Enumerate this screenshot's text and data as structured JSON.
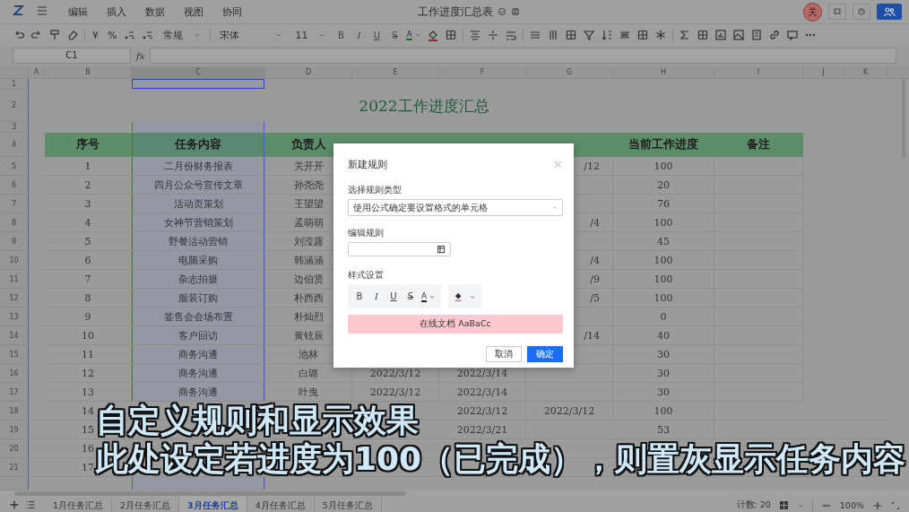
{
  "app_bar": {
    "menus": [
      "编辑",
      "插入",
      "数据",
      "视图",
      "协同"
    ],
    "doc_title": "工作进度汇总表",
    "avatar": "关"
  },
  "toolbar": {
    "currency": "¥",
    "percent": "%",
    "number_format": "常规",
    "font": "宋体",
    "font_size": "11",
    "text_styles": [
      {
        "label": "B",
        "kind": "bold"
      },
      {
        "label": "I",
        "kind": "italic"
      },
      {
        "label": "U",
        "kind": "underline"
      },
      {
        "label": "S",
        "kind": "strike"
      }
    ],
    "font_color": "A"
  },
  "formula_bar": {
    "cell": "C1",
    "fx": "fx"
  },
  "columns": [
    {
      "label": "A",
      "selected": false
    },
    {
      "label": "B",
      "selected": false
    },
    {
      "label": "C",
      "selected": true
    },
    {
      "label": "D",
      "selected": false
    },
    {
      "label": "E",
      "selected": false
    },
    {
      "label": "F",
      "selected": false
    },
    {
      "label": "G",
      "selected": false
    },
    {
      "label": "H",
      "selected": false
    },
    {
      "label": "I",
      "selected": false
    },
    {
      "label": "J",
      "selected": false
    },
    {
      "label": "K",
      "selected": false
    }
  ],
  "rows": [
    {
      "num": "1",
      "kind": "blank"
    },
    {
      "num": "2",
      "kind": "title",
      "title": "2022工作进度汇总"
    },
    {
      "num": "3",
      "kind": "blank"
    },
    {
      "num": "4",
      "kind": "header",
      "cells": {
        "b": "序号",
        "c": "任务内容",
        "d": "负责人",
        "h": "当前工作进度",
        "i": "备注"
      }
    },
    {
      "num": "5",
      "kind": "data",
      "cells": {
        "b": "1",
        "c": "二月份财务报表",
        "d": "关开开",
        "g": "/12",
        "h": "100"
      }
    },
    {
      "num": "6",
      "kind": "data",
      "cells": {
        "b": "2",
        "c": "四月公众号宣传文章",
        "d": "孙尧尧",
        "h": "20"
      }
    },
    {
      "num": "7",
      "kind": "data",
      "cells": {
        "b": "3",
        "c": "活动页策划",
        "d": "王望望",
        "h": "76"
      }
    },
    {
      "num": "8",
      "kind": "data",
      "cells": {
        "b": "4",
        "c": "女神节营销策划",
        "d": "孟萌萌",
        "g": "/4",
        "h": "100"
      }
    },
    {
      "num": "9",
      "kind": "data",
      "cells": {
        "b": "5",
        "c": "野餐活动营销",
        "d": "刘滢露",
        "h": "45"
      }
    },
    {
      "num": "10",
      "kind": "data",
      "cells": {
        "b": "6",
        "c": "电脑采购",
        "d": "韩涵涵",
        "g": "/4",
        "h": "100"
      }
    },
    {
      "num": "11",
      "kind": "data",
      "cells": {
        "b": "7",
        "c": "杂志拍摄",
        "d": "边伯贤",
        "g": "/9",
        "h": "100"
      }
    },
    {
      "num": "12",
      "kind": "data",
      "cells": {
        "b": "8",
        "c": "服装订购",
        "d": "朴西西",
        "g": "/5",
        "h": "100"
      }
    },
    {
      "num": "13",
      "kind": "data",
      "cells": {
        "b": "9",
        "c": "签售会会场布置",
        "d": "朴灿烈",
        "h": "0"
      }
    },
    {
      "num": "14",
      "kind": "data",
      "cells": {
        "b": "10",
        "c": "客户回访",
        "d": "黄铉辰",
        "g": "/14",
        "h": "40"
      }
    },
    {
      "num": "15",
      "kind": "data",
      "cells": {
        "b": "11",
        "c": "商务沟通",
        "d": "池林",
        "h": "30"
      }
    },
    {
      "num": "16",
      "kind": "data",
      "cells": {
        "b": "12",
        "c": "商务沟通",
        "d": "白璐",
        "e": "2022/3/12",
        "f": "2022/3/14",
        "h": "30"
      }
    },
    {
      "num": "17",
      "kind": "data",
      "cells": {
        "b": "13",
        "c": "商务沟通",
        "d": "叶曳",
        "e": "2022/3/12",
        "f": "2022/3/14",
        "h": "30"
      }
    },
    {
      "num": "18",
      "kind": "data",
      "cells": {
        "b": "14",
        "f": "2022/3/12",
        "g": "2022/3/12",
        "h": "100"
      }
    },
    {
      "num": "19",
      "kind": "data",
      "cells": {
        "b": "15",
        "f": "2022/3/21",
        "h": "53"
      }
    },
    {
      "num": "20",
      "kind": "data",
      "cells": {
        "b": "16"
      }
    },
    {
      "num": "21",
      "kind": "data",
      "cells": {
        "b": "17"
      }
    }
  ],
  "dialog": {
    "title": "新建规则",
    "type_label": "选择规则类型",
    "type_value": "使用公式确定要设置格式的单元格",
    "rule_label": "编辑规则",
    "style_label": "样式设置",
    "text_styles": [
      {
        "label": "B",
        "kind": "bold"
      },
      {
        "label": "I",
        "kind": "italic"
      },
      {
        "label": "U",
        "kind": "underline"
      },
      {
        "label": "S",
        "kind": "strike"
      }
    ],
    "font_color": "A",
    "preview": "在线文档 AaBaCc",
    "cancel": "取消",
    "ok": "确定"
  },
  "sheet_tabs": [
    {
      "label": "1月任务汇总",
      "selected": false
    },
    {
      "label": "2月任务汇总",
      "selected": false
    },
    {
      "label": "3月任务汇总",
      "selected": true
    },
    {
      "label": "4月任务汇总",
      "selected": false
    },
    {
      "label": "5月任务汇总",
      "selected": false
    }
  ],
  "status_bar": {
    "count": "计数: 20",
    "zoom": "100%"
  },
  "subtitles": [
    "自定义规则和显示效果",
    "此处设定若进度为100（已完成），则置灰显示任务内容"
  ]
}
